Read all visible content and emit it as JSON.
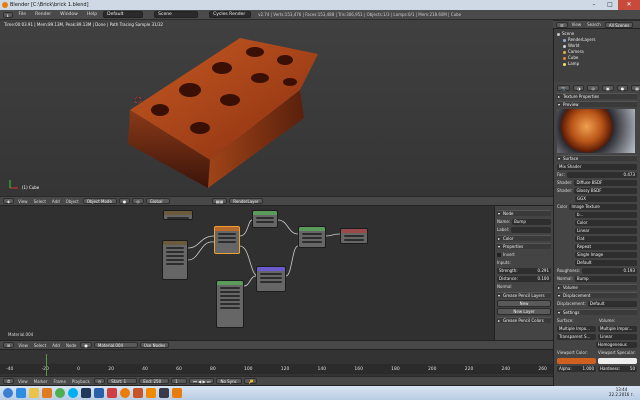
{
  "window": {
    "title": "Blender [C:\\Brick\\brick 1.blend]",
    "icon": "blender-logo-icon"
  },
  "topbar": {
    "menus": [
      "File",
      "Render",
      "Window",
      "Help"
    ],
    "layout": "Default",
    "scene": "Scene",
    "engine": "Cycles Render",
    "stats": "v2.74 | Verts:153,476 | Faces:153,488 | Tris:306,951 | Objects:1/3 | Lamps:0/1 | Mem:218.60M | Cube"
  },
  "viewport": {
    "info": [
      "Time:00:03.91 | Mem:89.13M, Peak:89.13M | Done | Path Tracing Sample 31/32"
    ],
    "object_label": "(1) Cube"
  },
  "viewport_header": {
    "menus": [
      "View",
      "Select",
      "Add",
      "Object"
    ],
    "mode": "Object Mode",
    "pivot": "Global",
    "layer": "RenderLayer"
  },
  "node_editor": {
    "material_label": "Material.004"
  },
  "node_header": {
    "menus": [
      "View",
      "Select",
      "Add",
      "Node"
    ],
    "material": "Material.004",
    "use_nodes": "Use Nodes"
  },
  "node_props": {
    "section_node": "Node",
    "name_label": "Name:",
    "name_value": "Bump",
    "label_label": "Label:",
    "section_color": "Color",
    "section_properties": "Properties",
    "invert": "Invert",
    "inputs_label": "Inputs:",
    "strength_label": "Strength:",
    "strength_value": "0.291",
    "distance_label": "Distance:",
    "distance_value": "0.100",
    "normal_label": "Normal",
    "section_grease": "Grease Pencil Layers",
    "new_button": "New",
    "new_layer_button": "New Layer",
    "section_grease_colors": "Grease Pencil Colors"
  },
  "timeline": {
    "ticks": [
      "-40",
      "-20",
      "0",
      "20",
      "40",
      "60",
      "80",
      "100",
      "120",
      "140",
      "160",
      "180",
      "200",
      "220",
      "240",
      "260"
    ],
    "menus": [
      "View",
      "Marker",
      "Frame",
      "Playback"
    ],
    "start": "Start: 1",
    "end": "End: 250",
    "current": "1",
    "sync": "No Sync"
  },
  "outliner": {
    "menus": [
      "View",
      "Search",
      "All Scenes"
    ],
    "items": [
      {
        "label": "Scene",
        "indent": 0,
        "color": "#c7c7c7"
      },
      {
        "label": "RenderLayers",
        "indent": 1,
        "color": "#8fb0d8"
      },
      {
        "label": "World",
        "indent": 1,
        "color": "#d0d0d0"
      },
      {
        "label": "Camera",
        "indent": 1,
        "color": "#e0b040"
      },
      {
        "label": "Cube",
        "indent": 1,
        "color": "#e08a30"
      },
      {
        "label": "Lamp",
        "indent": 1,
        "color": "#f0e070"
      }
    ]
  },
  "properties": {
    "texture_props": "Texture Properties",
    "preview": "Preview",
    "surface": "Surface",
    "surface_shader": "Mix Shader",
    "fac_label": "Fac:",
    "fac_value": "0.473",
    "shader1_label": "Shader:",
    "shader1_value": "Diffuse BSDF",
    "shader2_label": "Shader:",
    "shader2_value": "Glossy BSDF",
    "ggx": "GGX",
    "color_label": "Color",
    "color_value": "Image Texture",
    "image_name": "b...",
    "color_mode": "Color",
    "interp": "Linear",
    "proj": "Flat",
    "ext": "Repeat",
    "source": "Single Image",
    "vector": "Default",
    "roughness_label": "Roughness:",
    "roughness_value": "0.193",
    "normal_label": "Normal:",
    "normal_value": "Bump",
    "volume": "Volume",
    "displacement": "Displacement",
    "displacement_label": "Displacement:",
    "displacement_value": "Default",
    "settings": "Settings",
    "surface_col": "Surface:",
    "volume_col": "Volume:",
    "multiple_importance": "Multiple Impo...",
    "multiple_importance_vol": "Multiple Impor...",
    "transparent_shadows": "Transparent S...",
    "linear": "Linear",
    "homogeneous": "Homogeneous",
    "viewport_color": "Viewport Color:",
    "viewport_specular": "Viewport Specular:",
    "alpha_label": "Alpha:",
    "alpha_value": "1.000",
    "hardness_label": "Hardness:",
    "hardness_value": "50"
  },
  "taskbar": {
    "apps": [
      {
        "name": "windows-start-icon",
        "color": "#3b7fd4"
      },
      {
        "name": "internet-explorer-icon",
        "color": "#2d8de0"
      },
      {
        "name": "explorer-icon",
        "color": "#e9c34a"
      },
      {
        "name": "media-player-icon",
        "color": "#e07a20"
      },
      {
        "name": "chrome-icon",
        "color": "#4caf50"
      },
      {
        "name": "skype-icon",
        "color": "#00aff0"
      },
      {
        "name": "photoshop-icon",
        "color": "#1f3a5a"
      },
      {
        "name": "word-icon",
        "color": "#2b5fa8"
      },
      {
        "name": "paint-icon",
        "color": "#d04040"
      },
      {
        "name": "blender-icon",
        "color": "#e87d0d"
      },
      {
        "name": "powerpoint-icon",
        "color": "#c8542a"
      },
      {
        "name": "vlc-icon",
        "color": "#f08a00"
      },
      {
        "name": "steam-icon",
        "color": "#3a3a4a"
      },
      {
        "name": "blender-task-icon",
        "color": "#e87d0d"
      }
    ],
    "time": "13:44",
    "date": "22.2.2016 г."
  }
}
